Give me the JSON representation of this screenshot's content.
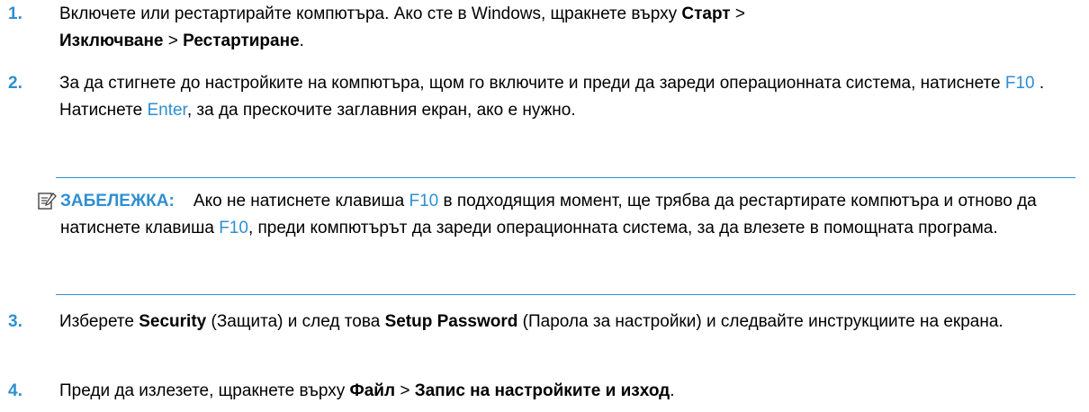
{
  "accent_color": "#2f8fd0",
  "steps": [
    {
      "num": "1.",
      "line1": "Включете или рестартирайте компютъра. Ако сте в Windows, щракнете върху ",
      "b1": "Старт",
      "sep1": " >",
      "b2": "Изключване",
      "sep2": " > ",
      "b3": "Рестартиране",
      "end": "."
    },
    {
      "num": "2.",
      "t1": "За да стигнете до настройките на компютъра, щом го включите и преди да зареди операционната система, натиснете ",
      "k1": "F10",
      "t2": " . Натиснете ",
      "k2": "Enter",
      "t3": ", за да прескочите заглавния екран, ако е нужно."
    },
    {
      "num": "3.",
      "t1": "Изберете ",
      "b1": "Security",
      "t2": " (Защита) и след това ",
      "b2": "Setup Password",
      "t3": " (Парола за настройки) и следвайте инструкциите на екрана."
    },
    {
      "num": "4.",
      "t1": "Преди да излезете, щракнете върху ",
      "b1": "Файл",
      "t2": " > ",
      "b2": "Запис на настройките и изход",
      "t3": "."
    }
  ],
  "note": {
    "icon": "note-pencil-icon",
    "label": "ЗАБЕЛЕЖКА:",
    "t1": "Ако не натиснете клавиша ",
    "k1": "F10",
    "t2": " в подходящия момент, ще трябва да рестартирате компютъра и отново да натиснете клавиша ",
    "k2": "F10",
    "t3": ", преди компютърът да зареди операционната система, за да влезете в помощната програма."
  }
}
